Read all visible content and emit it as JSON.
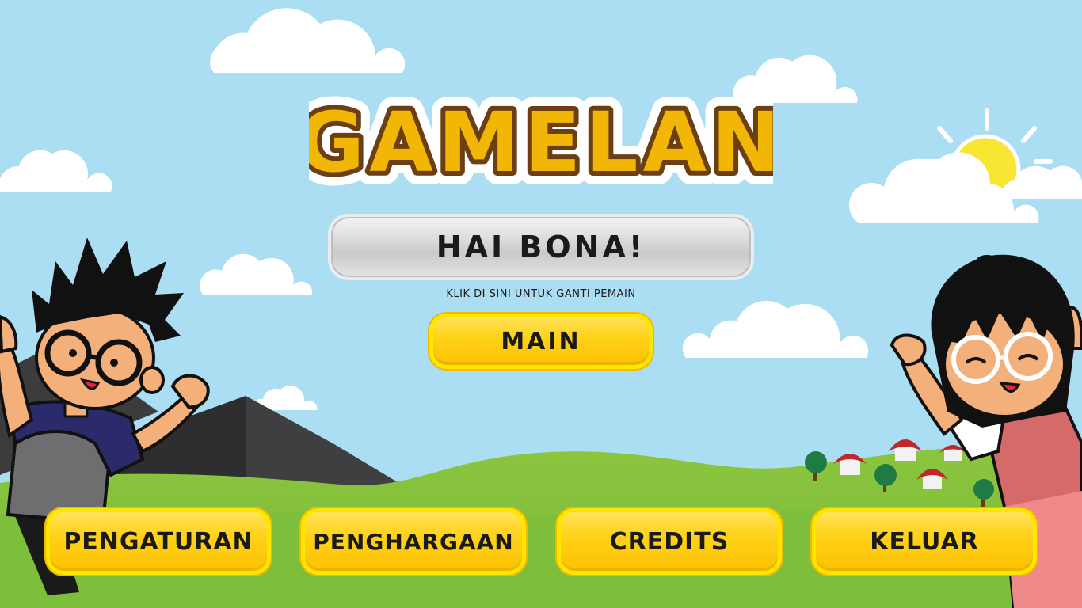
{
  "game": {
    "title": "GAMELAN",
    "player_greeting": "HAI BONA!",
    "switch_player_hint": "KLIK DI SINI UNTUK GANTI PEMAIN"
  },
  "menu": {
    "play_label": "MAIN",
    "settings_label": "PENGATURAN",
    "awards_label": "PENGHARGAAN",
    "credits_label": "CREDITS",
    "exit_label": "KELUAR"
  },
  "colors": {
    "sky": "#ABDDF3",
    "title_fill": "#F2B705",
    "title_outline": "#6B3F12",
    "button_fill": "#FFD21A",
    "button_border": "#FFE600",
    "hill_green": "#8CC63F",
    "mountain": "#3C3C3E",
    "sun": "#F7E733"
  },
  "icons": {
    "scene": [
      "cloud-icon",
      "sun-icon",
      "mountain-icon",
      "tree-icon",
      "house-icon",
      "boy-character",
      "girl-character"
    ]
  }
}
